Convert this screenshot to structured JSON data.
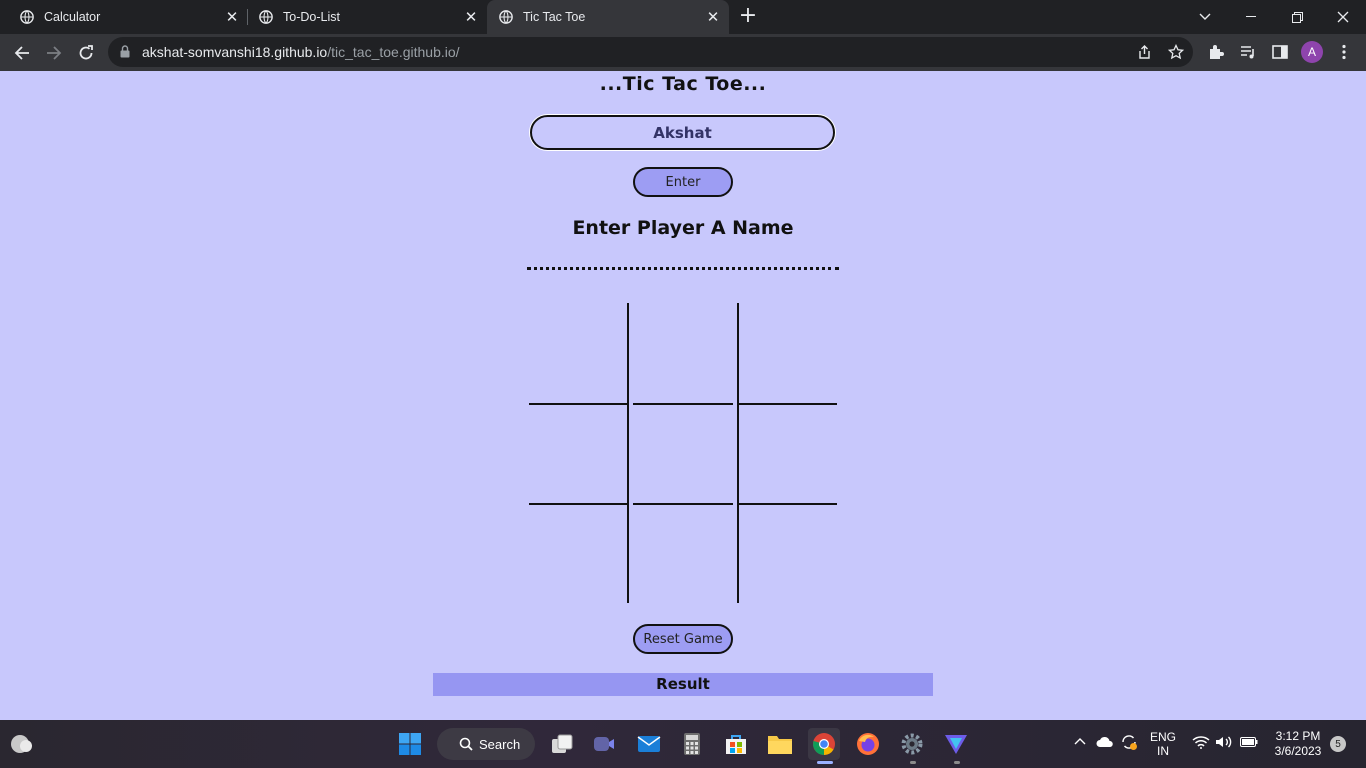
{
  "browser": {
    "tabs": [
      {
        "title": "Calculator",
        "active": false
      },
      {
        "title": "To-Do-List",
        "active": false
      },
      {
        "title": "Tic Tac Toe",
        "active": true
      }
    ],
    "url_host": "akshat-somvanshi18.github.io",
    "url_path": "/tic_tac_toe.github.io/",
    "profile_initial": "A"
  },
  "page": {
    "title": "...Tic Tac Toe...",
    "name_input_value": "Akshat",
    "enter_label": "Enter",
    "prompt": "Enter Player A Name",
    "reset_label": "Reset Game",
    "result_label": "Result",
    "board": [
      [
        "",
        "",
        ""
      ],
      [
        "",
        "",
        ""
      ],
      [
        "",
        "",
        ""
      ]
    ]
  },
  "taskbar": {
    "search_label": "Search",
    "lang_top": "ENG",
    "lang_bottom": "IN",
    "time": "3:12 PM",
    "date": "3/6/2023",
    "notification_count": "5",
    "apps": [
      "start-icon",
      "search-icon",
      "task-view-icon",
      "teams-icon",
      "mail-icon",
      "calculator-icon",
      "store-icon",
      "file-explorer-icon",
      "chrome-icon",
      "firefox-icon",
      "settings-icon",
      "vpn-icon"
    ]
  },
  "colors": {
    "page_bg": "#c8c8fc",
    "button_bg": "#9d9df3",
    "result_bg": "#9696f2",
    "chrome_dark": "#202124",
    "chrome_toolbar": "#35363a"
  }
}
